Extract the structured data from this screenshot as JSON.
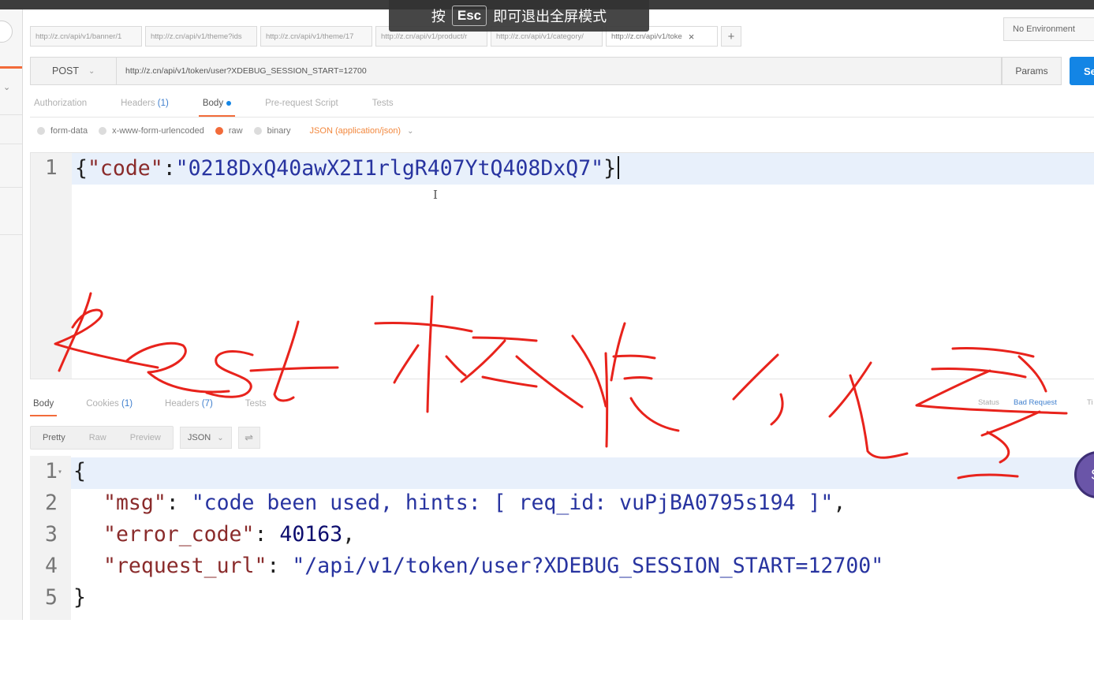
{
  "fullscreen_overlay": {
    "prefix": "按",
    "key": "Esc",
    "suffix": "即可退出全屏模式"
  },
  "request_tabs": [
    {
      "label": "http://z.cn/api/v1/banner/1"
    },
    {
      "label": "http://z.cn/api/v1/theme?ids"
    },
    {
      "label": "http://z.cn/api/v1/theme/17"
    },
    {
      "label": "http://z.cn/api/v1/product/r"
    },
    {
      "label": "http://z.cn/api/v1/category/"
    },
    {
      "label": "http://z.cn/api/v1/toke",
      "active": true
    }
  ],
  "tab_close_glyph": "×",
  "tab_add_glyph": "+",
  "environment": {
    "selected": "No Environment"
  },
  "request": {
    "method": "POST",
    "url": "http://z.cn/api/v1/token/user?XDEBUG_SESSION_START=12700",
    "params_label": "Params",
    "send_label": "Se"
  },
  "request_section_tabs": {
    "authorization": "Authorization",
    "headers": "Headers",
    "headers_count": "(1)",
    "body": "Body",
    "prerequest": "Pre-request Script",
    "tests": "Tests"
  },
  "body_types": {
    "form_data": "form-data",
    "urlencoded": "x-www-form-urlencoded",
    "raw": "raw",
    "binary": "binary",
    "selected": "raw",
    "content_type": "JSON (application/json)"
  },
  "request_body": {
    "line_number": "1",
    "brace_open": "{",
    "key": "\"code\"",
    "colon": ":",
    "value": "\"0218DxQ40awX2I1rlgR407YtQ408DxQ7\"",
    "brace_close": "}"
  },
  "response_section_tabs": {
    "body": "Body",
    "cookies": "Cookies",
    "cookies_count": "(1)",
    "headers": "Headers",
    "headers_count": "(7)",
    "tests": "Tests"
  },
  "response_status": {
    "status_label": "Status",
    "learn_link": "Bad Request",
    "time_label": "Ti"
  },
  "response_view": {
    "pretty": "Pretty",
    "raw": "Raw",
    "preview": "Preview",
    "format": "JSON",
    "wrap_glyph": "⇌"
  },
  "response_body": {
    "lines": [
      {
        "num": "1",
        "open": "{"
      },
      {
        "num": "2",
        "key": "\"msg\"",
        "sep": ": ",
        "value": "\"code been used, hints: [ req_id: vuPjBA0795s194 ]\"",
        "end": ","
      },
      {
        "num": "3",
        "key": "\"error_code\"",
        "sep": ": ",
        "value": "40163",
        "end": ","
      },
      {
        "num": "4",
        "key": "\"request_url\"",
        "sep": ": ",
        "value": "\"/api/v1/token/user?XDEBUG_SESSION_START=12700\"",
        "end": ""
      },
      {
        "num": "5",
        "close": "}"
      }
    ]
  },
  "avatar": {
    "letter": "S"
  },
  "annotation": {
    "ink_color": "#e8231c"
  },
  "colors": {
    "accent": "#f26b3a",
    "send_button": "#1385e5",
    "content_type": "#f2883e",
    "json_key": "#8a2b2b",
    "json_string": "#2834a0"
  },
  "icons": {
    "method_dropdown": "chevron-down-icon",
    "content_type_dropdown": "chevron-down-icon",
    "format_dropdown": "chevron-down-icon",
    "wrap": "wrap-lines-icon",
    "fold": "fold-caret-icon"
  }
}
